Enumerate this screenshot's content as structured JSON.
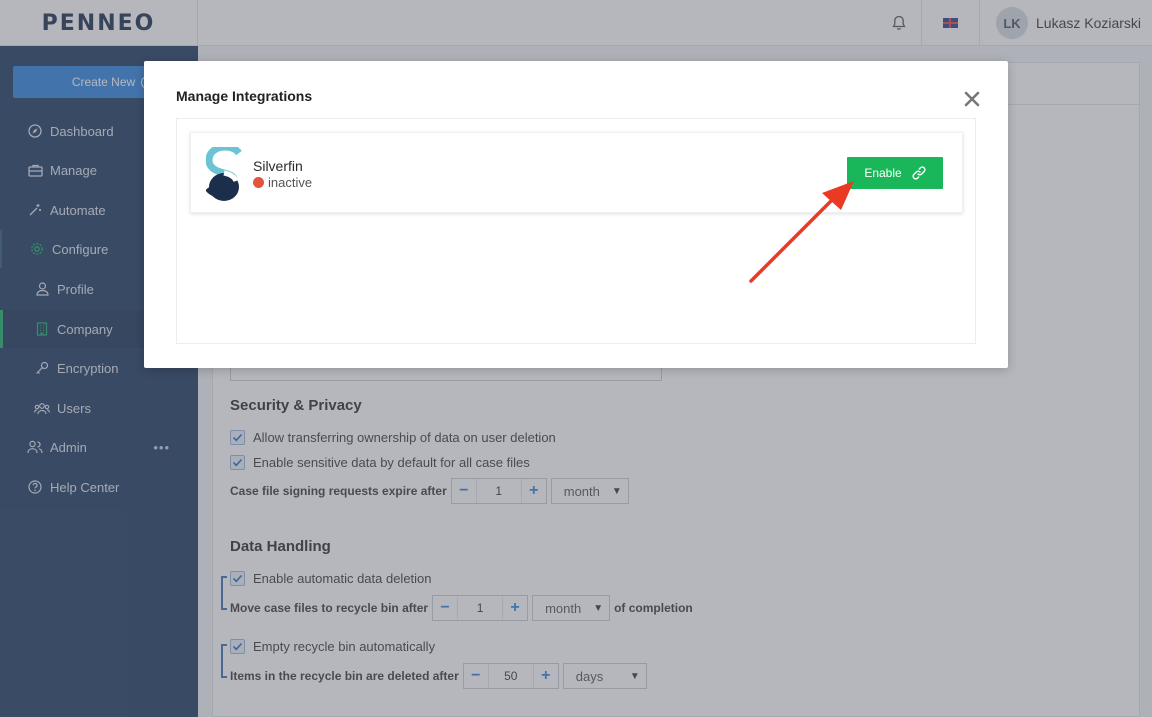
{
  "topbar": {
    "logo": "PENNEO",
    "user_initials": "LK",
    "user_name": "Lukasz Koziarski"
  },
  "sidebar": {
    "create_new": "Create New",
    "items": [
      {
        "label": "Dashboard",
        "icon": "compass-icon"
      },
      {
        "label": "Manage",
        "icon": "briefcase-icon"
      },
      {
        "label": "Automate",
        "icon": "magic-wand-icon"
      },
      {
        "label": "Configure",
        "icon": "gear-icon"
      },
      {
        "label": "Profile",
        "icon": "user-icon"
      },
      {
        "label": "Company",
        "icon": "building-icon"
      },
      {
        "label": "Encryption",
        "icon": "key-icon"
      },
      {
        "label": "Users",
        "icon": "users-icon"
      },
      {
        "label": "Admin",
        "icon": "user-group-icon",
        "more": "•••"
      },
      {
        "label": "Help Center",
        "icon": "question-circle-icon"
      }
    ]
  },
  "content": {
    "security": {
      "title": "Security & Privacy",
      "checkbox1": "Allow transferring ownership of data on user deletion",
      "checkbox2": "Enable sensitive data by default for all case files",
      "expire_label": "Case file signing requests expire after",
      "expire_value": "1",
      "expire_unit": "month"
    },
    "data_handling": {
      "title": "Data Handling",
      "checkbox1": "Enable automatic data deletion",
      "move_label": "Move case files to recycle bin after",
      "move_value": "1",
      "move_unit": "month",
      "move_suffix": "of completion",
      "checkbox2": "Empty recycle bin automatically",
      "delete_label": "Items in the recycle bin are deleted after",
      "delete_value": "50",
      "delete_unit": "days"
    },
    "stepper_minus": "−",
    "stepper_plus": "+"
  },
  "modal": {
    "title": "Manage Integrations",
    "integration": {
      "name": "Silverfin",
      "status": "inactive",
      "status_color": "#e5533d",
      "button": "Enable"
    }
  },
  "colors": {
    "sidebar_bg": "#1e3a5f",
    "accent_blue": "#2e86de",
    "enable_green": "#1ab65a",
    "arrow_red": "#ea3a24"
  }
}
